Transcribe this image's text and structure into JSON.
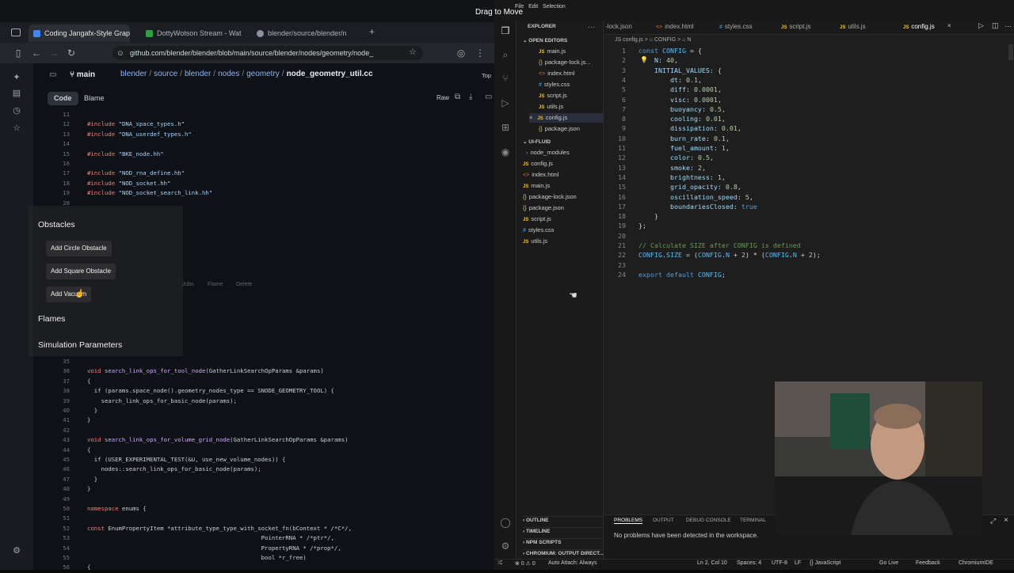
{
  "overlay_title": "Drag to Move",
  "browser": {
    "tabs": [
      {
        "label": "Coding Jangafx-Style Graphi",
        "color": "#4285f4"
      },
      {
        "label": "DottyWotson Stream - Wat",
        "color": "#2ea043"
      },
      {
        "label": "blender/source/blender/n",
        "color": "#8b949e"
      }
    ],
    "new_tab": "+",
    "url": "github.com/blender/blender/blob/main/source/blender/nodes/geometry/node_",
    "branch": "main",
    "breadcrumbs": [
      "blender",
      "source",
      "blender",
      "nodes",
      "geometry"
    ],
    "file": "node_geometry_util.cc",
    "top_label": "Top",
    "code_tab": "Code",
    "blame_tab": "Blame",
    "raw_button": "Raw"
  },
  "code_lines": [
    {
      "n": "11",
      "t": ""
    },
    {
      "n": "12",
      "pre": "#include ",
      "s": "\"DNA_space_types.h\""
    },
    {
      "n": "13",
      "pre": "#include ",
      "s": "\"DNA_userdef_types.h\""
    },
    {
      "n": "14",
      "t": ""
    },
    {
      "n": "15",
      "pre": "#include ",
      "s": "\"BKE_node.hh\""
    },
    {
      "n": "16",
      "t": ""
    },
    {
      "n": "17",
      "pre": "#include ",
      "s": "\"NOD_rna_define.hh\""
    },
    {
      "n": "18",
      "pre": "#include ",
      "s": "\"NOD_socket.hh\""
    },
    {
      "n": "19",
      "pre": "#include ",
      "s": "\"NOD_socket_search_link.hh\""
    },
    {
      "n": "20",
      "t": ""
    },
    {
      "n": "35",
      "t": ""
    },
    {
      "n": "36",
      "pre": "void ",
      "f": "search_link_ops_for_tool_node",
      "t": "(GatherLinkSearchOpParams &params)"
    },
    {
      "n": "37",
      "t": "{"
    },
    {
      "n": "38",
      "t": "  if (params.space_node().geometry_nodes_type == SNODE_GEOMETRY_TOOL) {"
    },
    {
      "n": "39",
      "t": "    search_link_ops_for_basic_node(params);"
    },
    {
      "n": "40",
      "t": "  }"
    },
    {
      "n": "41",
      "t": "}"
    },
    {
      "n": "42",
      "t": ""
    },
    {
      "n": "43",
      "pre": "void ",
      "f": "search_link_ops_for_volume_grid_node",
      "t": "(GatherLinkSearchOpParams &params)"
    },
    {
      "n": "44",
      "t": "{"
    },
    {
      "n": "45",
      "t": "  if (USER_EXPERIMENTAL_TEST(&U, use_new_volume_nodes)) {"
    },
    {
      "n": "46",
      "t": "    nodes::search_link_ops_for_basic_node(params);"
    },
    {
      "n": "47",
      "t": "  }"
    },
    {
      "n": "48",
      "t": "}"
    },
    {
      "n": "49",
      "t": ""
    },
    {
      "n": "50",
      "pre": "namespace ",
      "t": "enums {"
    },
    {
      "n": "51",
      "t": ""
    },
    {
      "n": "52",
      "pre": "const ",
      "t": "EnumPropertyItem *attribute_type_type_with_socket_fn(bContext * /*C*/,"
    },
    {
      "n": "53",
      "t": "                                                  PointerRNA * /*ptr*/,"
    },
    {
      "n": "54",
      "t": "                                                  PropertyRNA * /*prop*/,"
    },
    {
      "n": "55",
      "t": "                                                  bool *r_free)"
    },
    {
      "n": "56",
      "t": "{"
    }
  ],
  "overlay_panel": {
    "obstacles_heading": "Obstacles",
    "buttons": [
      "Add Circle Obstacle",
      "Add Square Obstacle",
      "Add Vacuum"
    ],
    "flames_heading": "Flames",
    "sim_heading": "Simulation Parameters",
    "faint_menu": [
      "Jobs",
      "Flame",
      "Delete"
    ]
  },
  "vscode": {
    "menu": [
      "File",
      "Edit",
      "Selection"
    ],
    "explorer_title": "EXPLORER",
    "open_editors_label": "OPEN EDITORS",
    "open_editors": [
      {
        "name": "main.js",
        "type": "js"
      },
      {
        "name": "package-lock.js...",
        "type": "json"
      },
      {
        "name": "index.html",
        "type": "html"
      },
      {
        "name": "styles.css",
        "type": "css"
      },
      {
        "name": "script.js",
        "type": "js"
      },
      {
        "name": "utils.js",
        "type": "js"
      },
      {
        "name": "config.js",
        "type": "js"
      },
      {
        "name": "package.json",
        "type": "json"
      }
    ],
    "project_label": "UI-FLUID",
    "project_files": [
      {
        "name": "node_modules",
        "type": "folder"
      },
      {
        "name": "config.js",
        "type": "js"
      },
      {
        "name": "index.html",
        "type": "html"
      },
      {
        "name": "main.js",
        "type": "js"
      },
      {
        "name": "package-lock.json",
        "type": "json"
      },
      {
        "name": "package.json",
        "type": "json"
      },
      {
        "name": "script.js",
        "type": "js"
      },
      {
        "name": "styles.css",
        "type": "css"
      },
      {
        "name": "utils.js",
        "type": "js"
      }
    ],
    "bottom_sections": [
      "OUTLINE",
      "TIMELINE",
      "NPM SCRIPTS",
      "CHROMIUM: OUTPUT DIRECT..."
    ],
    "editor_tabs": [
      "-lock.json",
      "index.html",
      "styles.css",
      "script.js",
      "utils.js",
      "config.js"
    ],
    "breadcrumb": "JS config.js > ⌂ CONFIG > ⌂ N",
    "panel_tabs": [
      "PROBLEMS",
      "OUTPUT",
      "DEBUG CONSOLE",
      "TERMINAL"
    ],
    "panel_message": "No problems have been detected in the workspace.",
    "status": {
      "errors": "⊗ 0 ⚠ 0",
      "auto_attach": "Auto Attach: Always",
      "position": "Ln 2, Col 10",
      "spaces": "Spaces: 4",
      "encoding": "UTF-8",
      "eol": "LF",
      "language": "{} JavaScript",
      "golive": "Go Live",
      "feedback": "Feedback",
      "ide": "ChromiumIDE"
    }
  },
  "editor_lines": [
    {
      "n": "1",
      "html": "<span class='v-kw'>const</span> <span class='v-var'>CONFIG</span> <span class='v-tx'>= {</span>"
    },
    {
      "n": "2",
      "html": "    <span class='v-prop'>N</span><span class='v-tx'>: </span><span class='v-num'>40</span><span class='v-tx'>,</span>"
    },
    {
      "n": "3",
      "html": "    <span class='v-prop'>INITIAL_VALUES</span><span class='v-tx'>: {</span>"
    },
    {
      "n": "4",
      "html": "        <span class='v-prop'>dt</span><span class='v-tx'>: </span><span class='v-num'>0.1</span><span class='v-tx'>,</span>"
    },
    {
      "n": "5",
      "html": "        <span class='v-prop'>diff</span><span class='v-tx'>: </span><span class='v-num'>0.0001</span><span class='v-tx'>,</span>"
    },
    {
      "n": "6",
      "html": "        <span class='v-prop'>visc</span><span class='v-tx'>: </span><span class='v-num'>0.0001</span><span class='v-tx'>,</span>"
    },
    {
      "n": "7",
      "html": "        <span class='v-prop'>buoyancy</span><span class='v-tx'>: </span><span class='v-num'>0.5</span><span class='v-tx'>,</span>"
    },
    {
      "n": "8",
      "html": "        <span class='v-prop'>cooling</span><span class='v-tx'>: </span><span class='v-num'>0.01</span><span class='v-tx'>,</span>"
    },
    {
      "n": "9",
      "html": "        <span class='v-prop'>dissipation</span><span class='v-tx'>: </span><span class='v-num'>0.01</span><span class='v-tx'>,</span>"
    },
    {
      "n": "10",
      "html": "        <span class='v-prop'>burn_rate</span><span class='v-tx'>: </span><span class='v-num'>0.1</span><span class='v-tx'>,</span>"
    },
    {
      "n": "11",
      "html": "        <span class='v-prop'>fuel_amount</span><span class='v-tx'>: </span><span class='v-num'>1</span><span class='v-tx'>,</span>"
    },
    {
      "n": "12",
      "html": "        <span class='v-prop'>color</span><span class='v-tx'>: </span><span class='v-num'>0.5</span><span class='v-tx'>,</span>"
    },
    {
      "n": "13",
      "html": "        <span class='v-prop'>smoke</span><span class='v-tx'>: </span><span class='v-num'>2</span><span class='v-tx'>,</span>"
    },
    {
      "n": "14",
      "html": "        <span class='v-prop'>brightness</span><span class='v-tx'>: </span><span class='v-num'>1</span><span class='v-tx'>,</span>"
    },
    {
      "n": "15",
      "html": "        <span class='v-prop'>grid_opacity</span><span class='v-tx'>: </span><span class='v-num'>0.8</span><span class='v-tx'>,</span>"
    },
    {
      "n": "16",
      "html": "        <span class='v-prop'>oscillation_speed</span><span class='v-tx'>: </span><span class='v-num'>5</span><span class='v-tx'>,</span>"
    },
    {
      "n": "17",
      "html": "        <span class='v-prop'>boundariesClosed</span><span class='v-tx'>: </span><span class='v-bool'>true</span>"
    },
    {
      "n": "18",
      "html": "    <span class='v-tx'>}</span>"
    },
    {
      "n": "19",
      "html": "<span class='v-tx'>};</span>"
    },
    {
      "n": "20",
      "html": ""
    },
    {
      "n": "21",
      "html": "<span class='v-cm'>// Calculate SIZE after CONFIG is defined</span>"
    },
    {
      "n": "22",
      "html": "<span class='v-var'>CONFIG</span><span class='v-tx'>.</span><span class='v-var'>SIZE</span><span class='v-tx'> = (</span><span class='v-var'>CONFIG</span><span class='v-tx'>.</span><span class='v-var'>N</span><span class='v-tx'> + </span><span class='v-num'>2</span><span class='v-tx'>) * (</span><span class='v-var'>CONFIG</span><span class='v-tx'>.</span><span class='v-var'>N</span><span class='v-tx'> + </span><span class='v-num'>2</span><span class='v-tx'>);</span>"
    },
    {
      "n": "23",
      "html": ""
    },
    {
      "n": "24",
      "html": "<span class='v-kw'>export default</span> <span class='v-var'>CONFIG</span><span class='v-tx'>;</span>"
    }
  ]
}
